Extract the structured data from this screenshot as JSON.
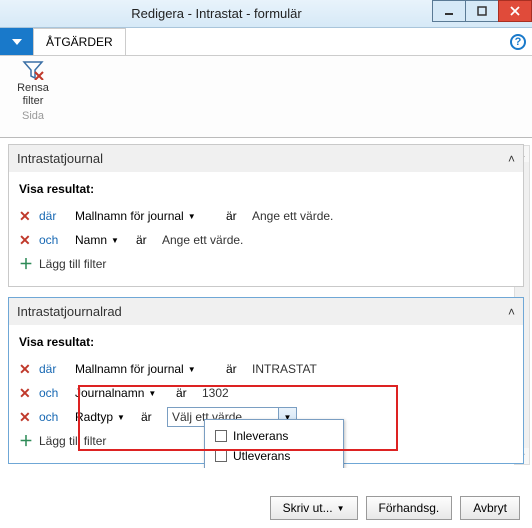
{
  "window": {
    "title": "Redigera - Intrastat - formulär"
  },
  "menu": {
    "actions_tab": "ÅTGÄRDER"
  },
  "ribbon": {
    "clear_filter_line1": "Rensa",
    "clear_filter_line2": "filter",
    "group": "Sida"
  },
  "panel1": {
    "title": "Intrastatjournal",
    "show_result": "Visa resultat:",
    "rows": [
      {
        "conj": "där",
        "field": "Mallnamn för journal",
        "op": "är",
        "value": "Ange ett värde."
      },
      {
        "conj": "och",
        "field": "Namn",
        "op": "är",
        "value": "Ange ett värde."
      }
    ],
    "add_filter": "Lägg till filter"
  },
  "panel2": {
    "title": "Intrastatjournalrad",
    "show_result": "Visa resultat:",
    "rows": [
      {
        "conj": "där",
        "field": "Mallnamn för journal",
        "op": "är",
        "value": "INTRASTAT"
      },
      {
        "conj": "och",
        "field": "Journalnamn",
        "op": "är",
        "value": "1302"
      },
      {
        "conj": "och",
        "field": "Radtyp",
        "op": "är",
        "value_select": "Välj ett värde"
      }
    ],
    "options": [
      "Inleverans",
      "Utleverans"
    ],
    "add_filter": "Lägg till filter"
  },
  "footer": {
    "print": "Skriv ut...",
    "preview": "Förhandsg.",
    "cancel": "Avbryt"
  }
}
